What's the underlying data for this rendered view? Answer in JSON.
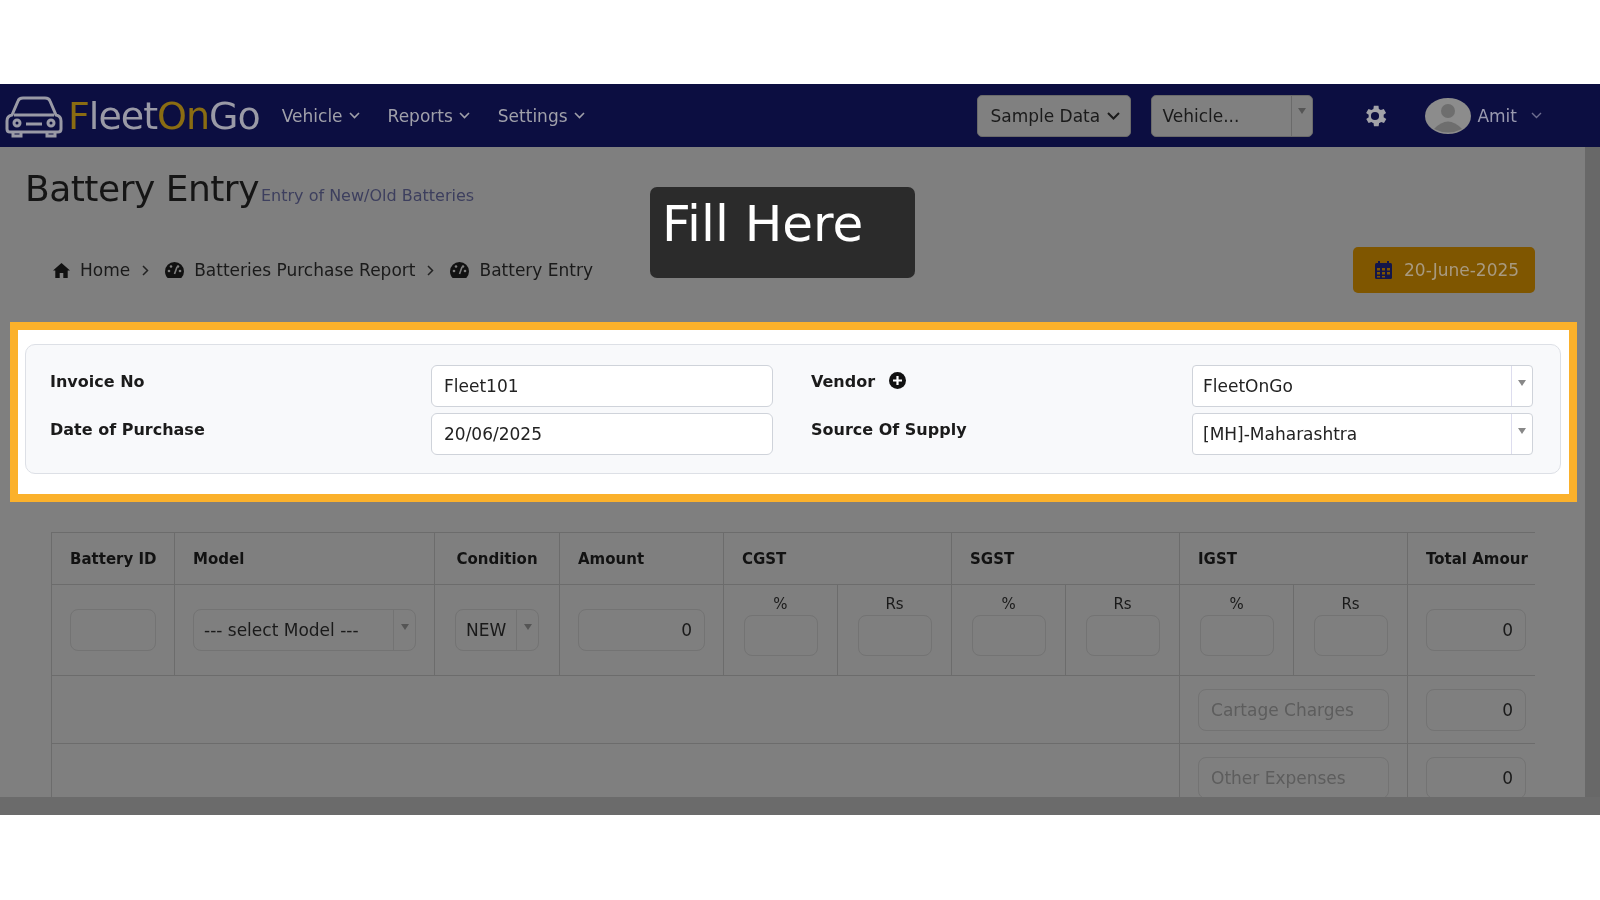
{
  "header": {
    "logo": [
      {
        "text": "F",
        "accent": true
      },
      {
        "text": "leet",
        "accent": false
      },
      {
        "text": "On",
        "accent": true
      },
      {
        "text": "Go",
        "accent": false
      }
    ],
    "nav": [
      "Vehicle",
      "Reports",
      "Settings"
    ],
    "sample_select": "Sample Data",
    "vehicle_select": "Vehicle...",
    "user": "Amit"
  },
  "page": {
    "title": "Battery Entry",
    "subtitle": "Entry of New/Old Batteries",
    "breadcrumb": [
      {
        "label": "Home",
        "kind": "home"
      },
      {
        "label": "Batteries Purchase Report",
        "kind": "gauge"
      },
      {
        "label": "Battery Entry",
        "kind": "gauge"
      }
    ],
    "date": "20-June-2025"
  },
  "tour_tooltip": "Fill Here",
  "form": {
    "left": [
      {
        "label": "Invoice No",
        "value": "Fleet101"
      },
      {
        "label": "Date of Purchase",
        "value": "20/06/2025"
      }
    ],
    "right": [
      {
        "label": "Vendor",
        "value": "FleetOnGo",
        "add_button": true
      },
      {
        "label": "Source Of Supply",
        "value": "[MH]-Maharashtra",
        "add_button": false
      }
    ]
  },
  "table": {
    "columns": [
      {
        "label": "Battery ID"
      },
      {
        "label": "Model"
      },
      {
        "label": "Condition"
      },
      {
        "label": "Amount"
      },
      {
        "label": "CGST",
        "sub": [
          "%",
          "Rs"
        ]
      },
      {
        "label": "SGST",
        "sub": [
          "%",
          "Rs"
        ]
      },
      {
        "label": "IGST",
        "sub": [
          "%",
          "Rs"
        ]
      },
      {
        "label": "Total Amour"
      }
    ],
    "row": {
      "model_placeholder": "--- select Model ---",
      "condition": "NEW",
      "amount": "0",
      "total": "0"
    },
    "charges": [
      {
        "placeholder": "Cartage Charges",
        "value": "0"
      },
      {
        "placeholder": "Other Expenses",
        "value": "0"
      }
    ]
  }
}
